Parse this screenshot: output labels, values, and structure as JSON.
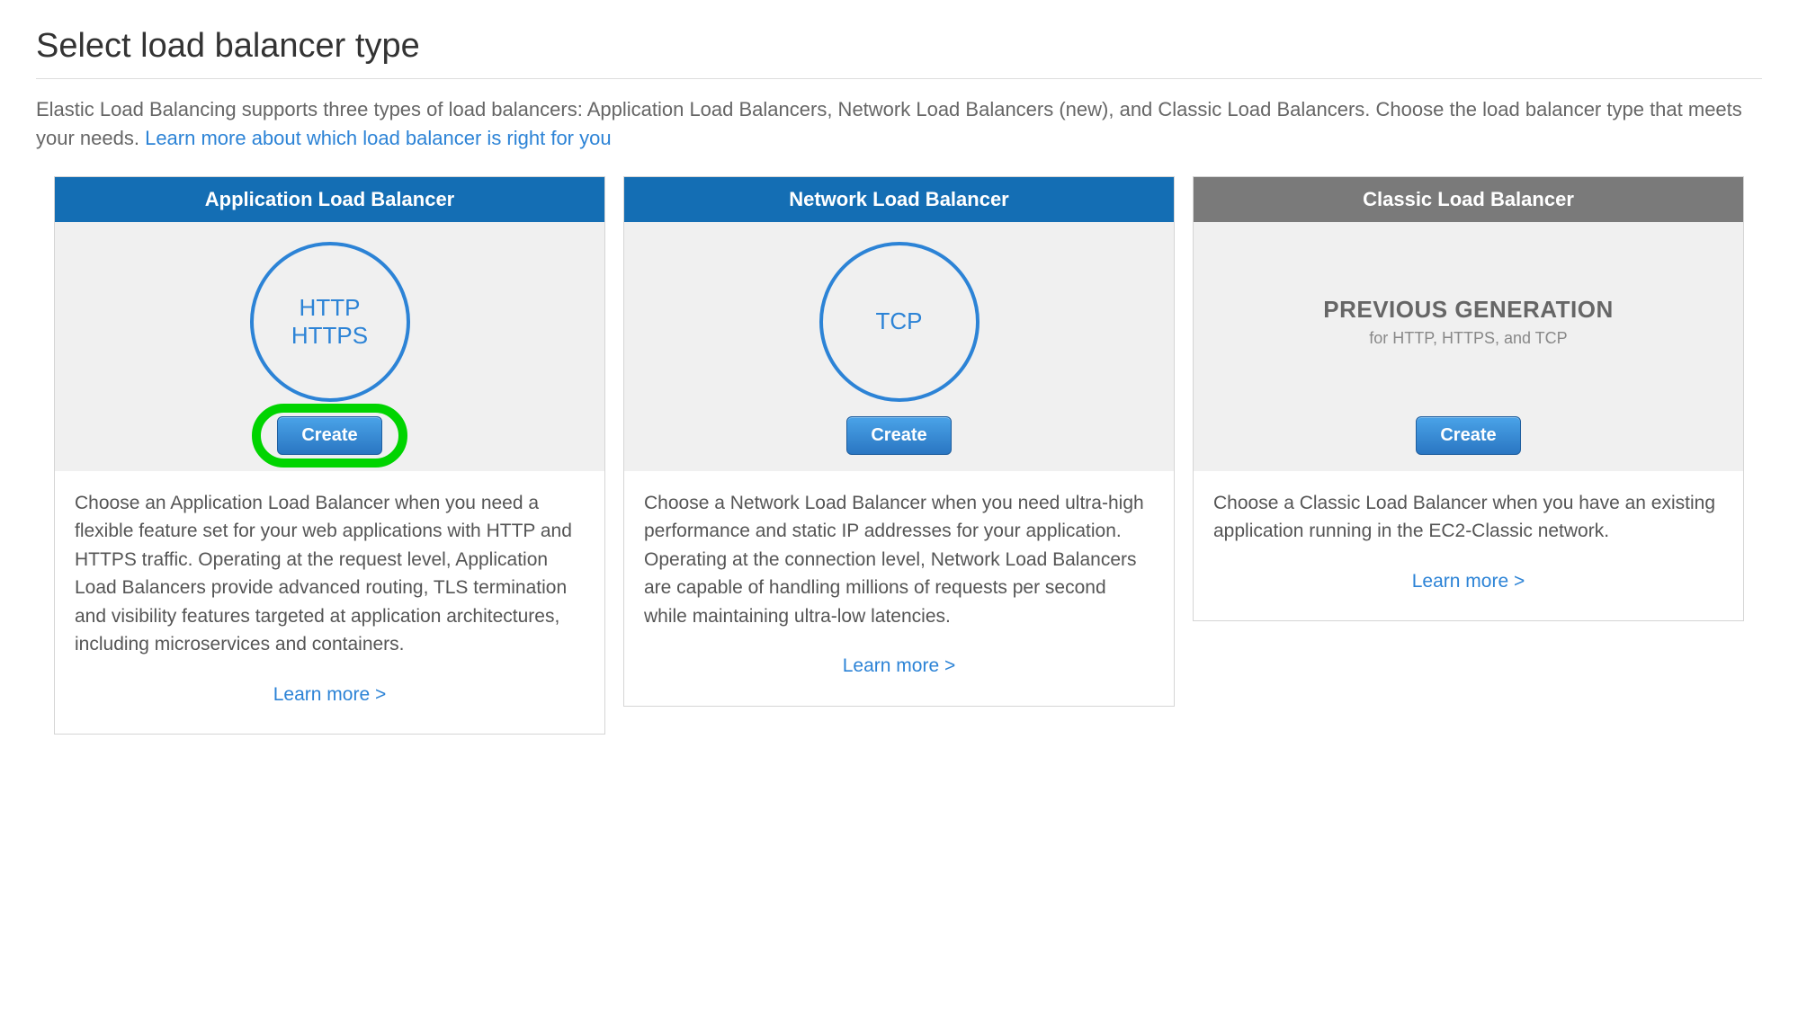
{
  "page": {
    "title": "Select load balancer type",
    "intro": "Elastic Load Balancing supports three types of load balancers: Application Load Balancers, Network Load Balancers (new), and Classic Load Balancers. Choose the load balancer type that meets your needs. ",
    "intro_link": "Learn more about which load balancer is right for you"
  },
  "cards": [
    {
      "title": "Application Load Balancer",
      "protocol_line1": "HTTP",
      "protocol_line2": "HTTPS",
      "create_label": "Create",
      "description": "Choose an Application Load Balancer when you need a flexible feature set for your web applications with HTTP and HTTPS traffic. Operating at the request level, Application Load Balancers provide advanced routing, TLS termination and visibility features targeted at application architectures, including microservices and containers.",
      "learn_more": "Learn more >"
    },
    {
      "title": "Network Load Balancer",
      "protocol_line1": "TCP",
      "create_label": "Create",
      "description": "Choose a Network Load Balancer when you need ultra-high performance and static IP addresses for your application. Operating at the connection level, Network Load Balancers are capable of handling millions of requests per second while maintaining ultra-low latencies.",
      "learn_more": "Learn more >"
    },
    {
      "title": "Classic Load Balancer",
      "prev_gen_title": "PREVIOUS GENERATION",
      "prev_gen_sub": "for HTTP, HTTPS, and TCP",
      "create_label": "Create",
      "description": "Choose a Classic Load Balancer when you have an existing application running in the EC2-Classic network.",
      "learn_more": "Learn more >"
    }
  ]
}
